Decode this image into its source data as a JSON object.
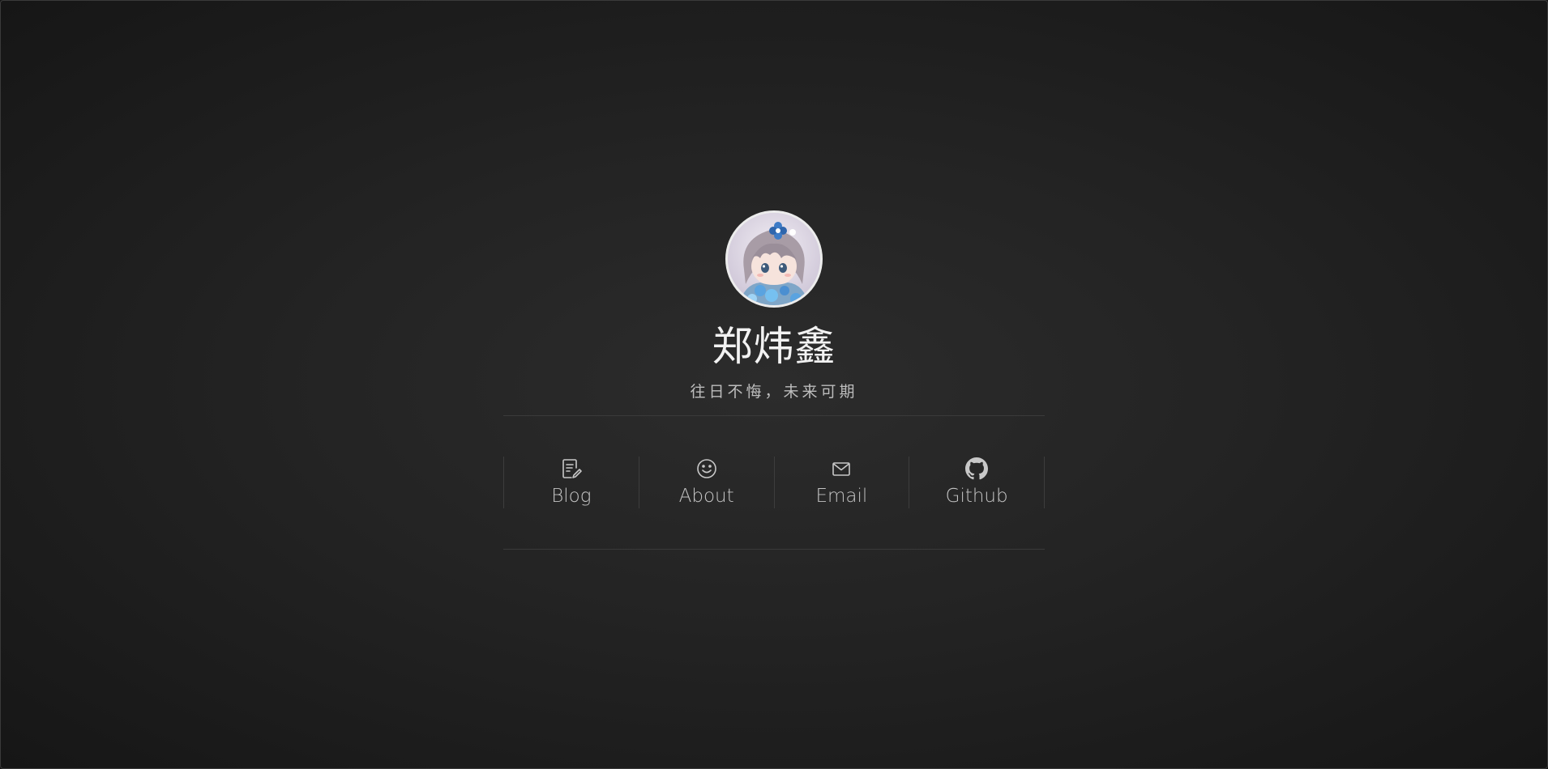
{
  "profile": {
    "name": "郑炜鑫",
    "motto": "往日不悔，未来可期",
    "avatar_icon": "anime-avatar"
  },
  "nav": {
    "items": [
      {
        "label": "Blog",
        "icon": "edit-document-icon"
      },
      {
        "label": "About",
        "icon": "smiley-icon"
      },
      {
        "label": "Email",
        "icon": "mail-icon"
      },
      {
        "label": "Github",
        "icon": "github-icon"
      }
    ]
  },
  "colors": {
    "background": "#232323",
    "text": "#f2f2f2",
    "muted": "#c4c4c4",
    "divider": "#3a3a3a"
  }
}
